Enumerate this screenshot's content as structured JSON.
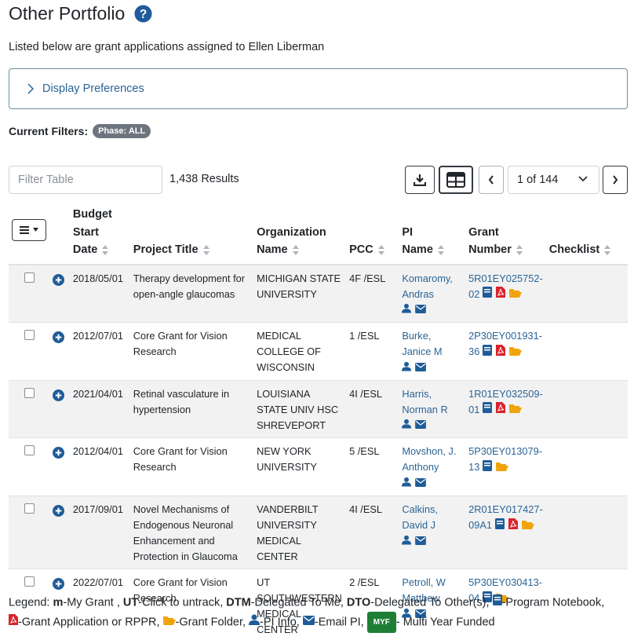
{
  "page": {
    "title": "Other Portfolio",
    "subtitle": "Listed below are grant applications assigned to Ellen Liberman",
    "display_prefs_label": "Display Preferences",
    "filters_label": "Current Filters:",
    "filter_badge": "Phase: ALL",
    "filter_placeholder": "Filter Table",
    "results": "1,438 Results",
    "pager": "1 of 144"
  },
  "table": {
    "headers": {
      "budget_start": [
        "Budget",
        "Start",
        "Date"
      ],
      "project_title": "Project Title",
      "org": [
        "Organization",
        "Name"
      ],
      "pcc": "PCC",
      "pi": [
        "PI",
        "Name"
      ],
      "grant": [
        "Grant",
        "Number"
      ],
      "checklist": "Checklist"
    },
    "rows": [
      {
        "date": "2018/05/01",
        "title": "Therapy development for open-angle glaucomas",
        "org": "MICHIGAN STATE UNIVERSITY",
        "pcc": "4F /ESL",
        "pi": "Komaromy, Andras",
        "grant": "5R01EY025752-02",
        "icons": [
          "notebook",
          "pdf",
          "folder"
        ]
      },
      {
        "date": "2012/07/01",
        "title": "Core Grant for Vision Research",
        "org": "MEDICAL COLLEGE OF WISCONSIN",
        "pcc": "1 /ESL",
        "pi": "Burke, Janice M",
        "grant": "2P30EY001931-36",
        "icons": [
          "notebook",
          "pdf",
          "folder"
        ]
      },
      {
        "date": "2021/04/01",
        "title": "Retinal vasculature in hypertension",
        "org": "LOUISIANA STATE UNIV HSC SHREVEPORT",
        "pcc": "4I /ESL",
        "pi": "Harris, Norman R",
        "grant": "1R01EY032509-01",
        "icons": [
          "notebook",
          "pdf",
          "folder"
        ]
      },
      {
        "date": "2012/04/01",
        "title": "Core Grant for Vision Research",
        "org": "NEW YORK UNIVERSITY",
        "pcc": "5 /ESL",
        "pi": "Movshon, J. Anthony",
        "grant": "5P30EY013079-13",
        "icons": [
          "notebook",
          "folder"
        ]
      },
      {
        "date": "2017/09/01",
        "title": "Novel Mechanisms of Endogenous Neuronal Enhancement and Protection in Glaucoma",
        "org": "VANDERBILT UNIVERSITY MEDICAL CENTER",
        "pcc": "4I /ESL",
        "pi": "Calkins, David J",
        "grant": "2R01EY017427-09A1",
        "icons": [
          "notebook",
          "pdf",
          "folder"
        ]
      },
      {
        "date": "2022/07/01",
        "title": "Core Grant for Vision Research",
        "org": "UT SOUTHWESTERN MEDICAL CENTER",
        "pcc": "2 /ESL",
        "pi": "Petroll, W Matthew",
        "grant": "5P30EY030413-04",
        "icons": [
          "notebook",
          "folder"
        ]
      }
    ]
  },
  "legend": {
    "prefix": "Legend: ",
    "m": "m",
    "m_text": "-My Grant , ",
    "ut": "UT",
    "ut_text": "-Click to untrack, ",
    "dtm": "DTM",
    "dtm_text": "-Delegated To Me, ",
    "dto": "DTO",
    "dto_text": "-Delegated To Other(s), ",
    "notebook_text": "-Program Notebook,",
    "pdf_text": "-Grant Application or RPPR, ",
    "folder_text": "-Grant Folder, ",
    "pi_text": "-PI Info, ",
    "email_text": "-Email PI, ",
    "myf": "MYF",
    "myf_text": "- Multi Year Funded"
  },
  "colors": {
    "link": "#2a6496",
    "notebook": "#1f5c99",
    "pdf": "#d9232d",
    "folder": "#f0a30a",
    "myf": "#1e7e34"
  }
}
